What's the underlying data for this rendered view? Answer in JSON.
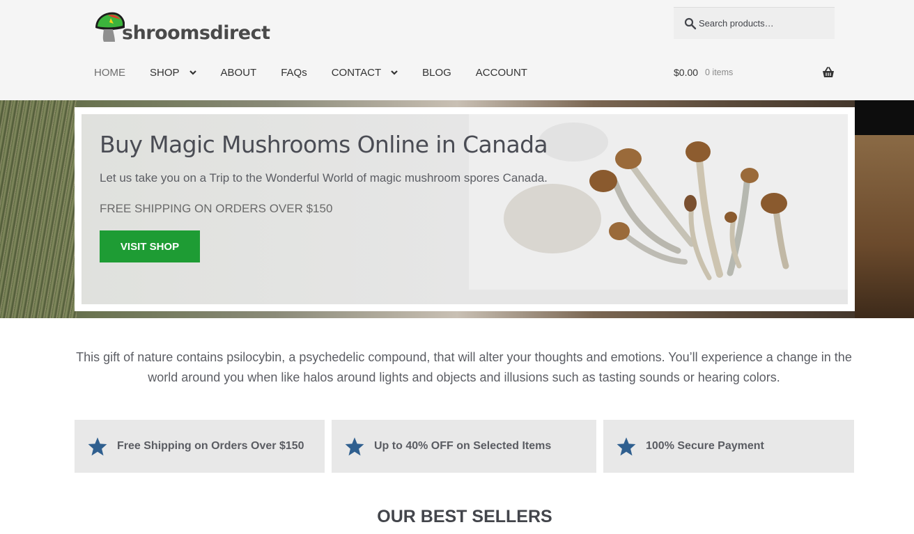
{
  "header": {
    "logo_text": "shroomsdirect",
    "search": {
      "placeholder": "Search products…"
    },
    "nav": [
      {
        "label": "HOME"
      },
      {
        "label": "SHOP"
      },
      {
        "label": "ABOUT"
      },
      {
        "label": "FAQs"
      },
      {
        "label": "CONTACT"
      },
      {
        "label": "BLOG"
      },
      {
        "label": "ACCOUNT"
      }
    ],
    "cart": {
      "total": "$0.00",
      "count": "0 items"
    }
  },
  "hero": {
    "title": "Buy Magic Mushrooms Online in Canada",
    "subtitle": "Let us take you on a Trip to the Wonderful World of magic mushroom spores Canada.",
    "shipping": "FREE SHIPPING ON ORDERS OVER $150",
    "button_label": "VISIT SHOP"
  },
  "intro": {
    "line1": "This gift of nature contains psilocybin, a psychedelic compound, that will alter your thoughts and emotions. You’ll experience a change in the",
    "line2": "world around you when like halos around lights and objects and illusions such as tasting sounds or hearing colors."
  },
  "features": [
    {
      "text": "Free Shipping on Orders Over $150",
      "icon": "star-icon"
    },
    {
      "text": "Up to 40% OFF on Selected Items",
      "icon": "star-icon"
    },
    {
      "text": "100% Secure Payment",
      "icon": "star-icon"
    }
  ],
  "best_sellers": {
    "heading": "OUR BEST SELLERS"
  },
  "colors": {
    "header_bg": "#f5f5f5",
    "button_green": "#1e9c34",
    "star_blue": "#2f5f8f",
    "feature_bg": "#e8e8e8",
    "text": "#43454b"
  }
}
